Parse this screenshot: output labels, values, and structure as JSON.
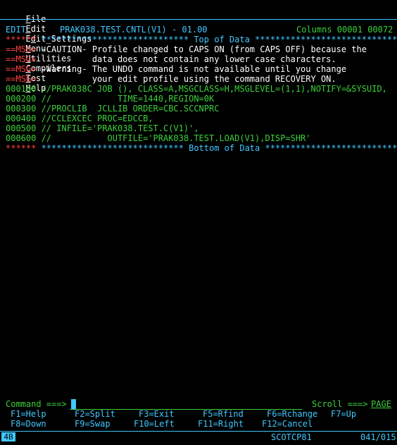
{
  "menu": {
    "items": [
      "File",
      "Edit",
      "Edit_Settings",
      "Menu",
      "Utilities",
      "Compilers",
      "Test",
      "Help"
    ],
    "underline": [
      "F",
      "E",
      "d",
      "M",
      "U",
      "C",
      "T",
      "H"
    ]
  },
  "header": {
    "mode": "EDIT",
    "dataset": "PRAK038.TEST.CNTL(V1) - 01.00",
    "columns": "Columns 00001 00072"
  },
  "lines": {
    "top_prefix": "******",
    "top_text": " ***************************** Top of Data ******************************",
    "msg1_prefix": "==MSG>",
    "msg1_text": " -CAUTION- Profile changed to CAPS ON (from CAPS OFF) because the",
    "msg2_prefix": "==MSG>",
    "msg2_text": "           data does not contain any lower case characters.",
    "msg3_prefix": "==MSG>",
    "msg3_text": " -Warning- The UNDO command is not available until you change",
    "msg4_prefix": "==MSG>",
    "msg4_text": "           your edit profile using the command RECOVERY ON.",
    "l1_num": "000100",
    "l1_text": " //PRAK038C JOB (), CLASS=A,MSGCLASS=H,MSGLEVEL=(1,1),NOTIFY=&SYSUID,",
    "l2_num": "000200",
    "l2_text": " //             TIME=1440,REGION=0K",
    "l3_num": "000300",
    "l3_text": " //PROCLIB  JCLLIB ORDER=CBC.SCCNPRC",
    "l4_num": "000400",
    "l4_text": " //CCLEXCEC PROC=EDCCB,",
    "l5_num": "000500",
    "l5_text": " // INFILE='PRAK038.TEST.C(V1)',",
    "l6_num": "000600",
    "l6_text": " //           OUTFILE='PRAK038.TEST.LOAD(V1),DISP=SHR'",
    "bottom_prefix": "******",
    "bottom_text": " **************************** Bottom of Data ****************************"
  },
  "command": {
    "label": "Command ===>",
    "value": "",
    "scroll_label": "Scroll ===>",
    "scroll_value": "PAGE"
  },
  "pfkeys": {
    "f1": "F1=Help",
    "f2": "F2=Split",
    "f3": "F3=Exit",
    "f5": "F5=Rfind",
    "f6": "F6=Rchange",
    "f7": "F7=Up",
    "f8": "F8=Down",
    "f9": "F9=Swap",
    "f10": "F10=Left",
    "f11": "F11=Right",
    "f12": "F12=Cancel"
  },
  "status": {
    "indicator": "4B",
    "session": "SCOTCP81",
    "position": "041/015"
  },
  "colors": {
    "background": "#000000",
    "cyan": "#40c8ff",
    "green": "#3cd23c",
    "red": "#ff4040",
    "white": "#ffffff"
  }
}
